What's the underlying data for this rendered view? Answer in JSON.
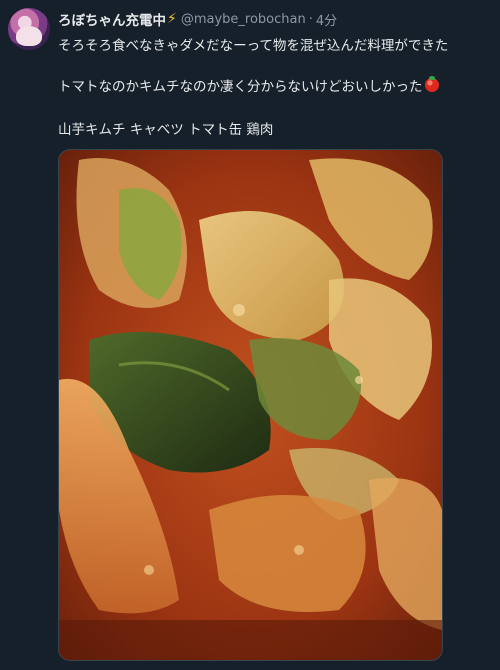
{
  "tweet": {
    "author_name": "ろぼちゃん充電中",
    "author_badge_icon": "lightning-bolt-icon",
    "handle": "@maybe_robochan",
    "separator": "·",
    "time": "4分",
    "text_line1": "そろそろ食べなきゃダメだなーって物を混ぜ込んだ料理ができた",
    "text_line2": "トマトなのかキムチなのか凄く分からないけどおいしかった",
    "text_line2_emoji": "tomato-icon",
    "text_line3": "山芋キムチ キャベツ トマト缶 鶏肉"
  },
  "colors": {
    "background": "#15202b",
    "text": "#e7e9ea",
    "muted": "#8b98a5"
  }
}
